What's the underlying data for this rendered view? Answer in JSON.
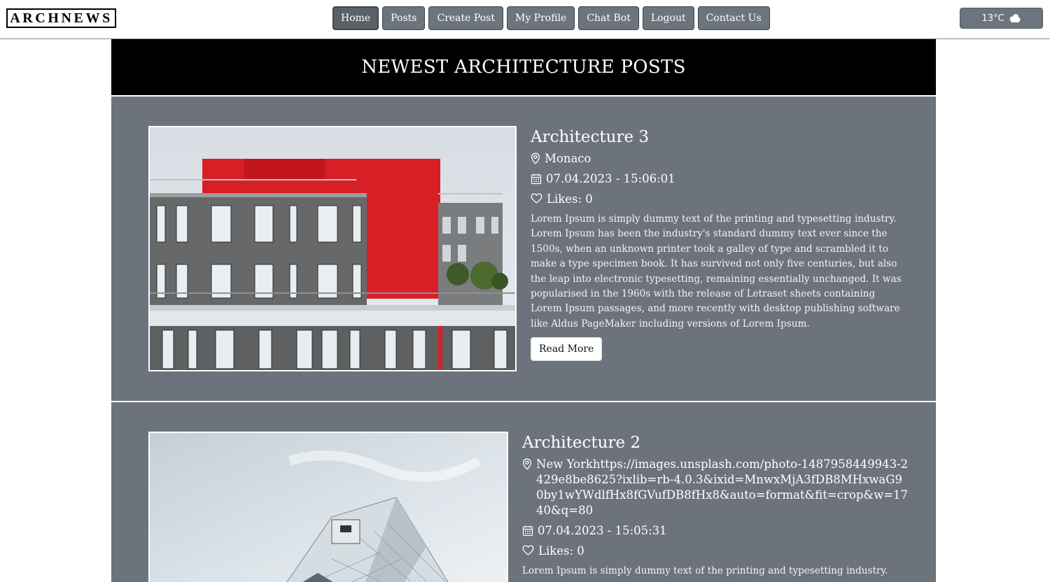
{
  "navbar": {
    "logo": "ARCHNEWS",
    "items": [
      {
        "label": "Home",
        "active": true
      },
      {
        "label": "Posts"
      },
      {
        "label": "Create Post"
      },
      {
        "label": "My Profile"
      },
      {
        "label": "Chat Bot"
      },
      {
        "label": "Logout"
      },
      {
        "label": "Contact Us"
      }
    ],
    "weather": {
      "temp": "13°C",
      "icon": "cloud-icon"
    }
  },
  "page": {
    "title": "NEWEST ARCHITECTURE POSTS"
  },
  "posts": [
    {
      "title": "Architecture 3",
      "location": "Monaco",
      "datetime": "07.04.2023 - 15:06:01",
      "likes": "Likes: 0",
      "description": "Lorem Ipsum is simply dummy text of the printing and typesetting industry. Lorem Ipsum has been the industry's standard dummy text ever since the 1500s, when an unknown printer took a galley of type and scrambled it to make a type specimen book. It has survived not only five centuries, but also the leap into electronic typesetting, remaining essentially unchanged. It was popularised in the 1960s with the release of Letraset sheets containing Lorem Ipsum passages, and more recently with desktop publishing software like Aldus PageMaker including versions of Lorem Ipsum.",
      "button": "Read More"
    },
    {
      "title": "Architecture 2",
      "location": "New Yorkhttps://images.unsplash.com/photo-1487958449943-2429e8be8625?ixlib=rb-4.0.3&ixid=MnwxMjA3fDB8MHxwaG90by1wYWdlfHx8fGVufDB8fHx8&auto=format&fit=crop&w=1740&q=80",
      "datetime": "07.04.2023 - 15:05:31",
      "likes": "Likes: 0",
      "description": "Lorem Ipsum is simply dummy text of the printing and typesetting industry."
    }
  ],
  "colors": {
    "nav_button": "#6c757d",
    "post_bg": "#6c737c",
    "header_bg": "#000000",
    "accent_red": "#d81f26"
  }
}
